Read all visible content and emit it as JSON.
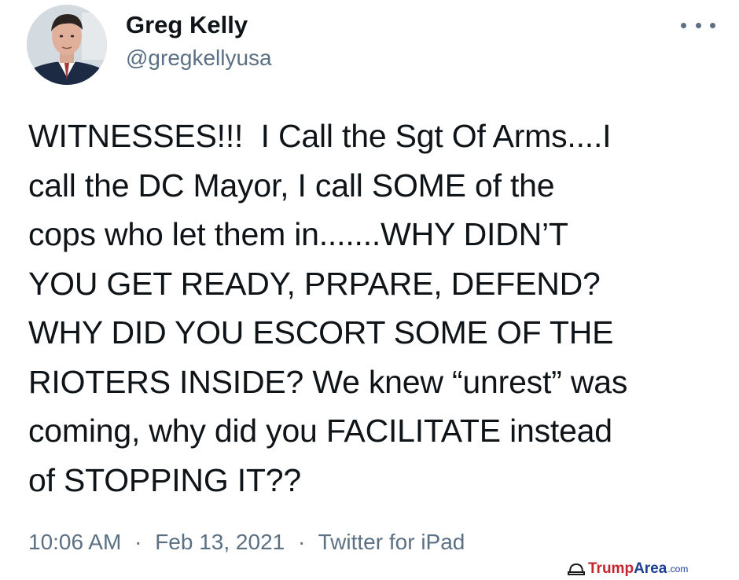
{
  "tweet": {
    "author_name": "Greg Kelly",
    "author_handle": "@gregkellyusa",
    "more_icon": "more-dots-icon",
    "text_lines": [
      "WITNESSES!!!  I Call the Sgt Of Arms....I",
      "call the DC Mayor, I call SOME of the",
      "cops who let them in.......WHY DIDN’T",
      "YOU GET READY, PRPARE, DEFEND?",
      "WHY DID YOU ESCORT SOME OF THE",
      "RIOTERS INSIDE? We knew “unrest” was",
      "coming, why did you FACILITATE instead",
      "of STOPPING IT??"
    ],
    "time": "10:06 AM",
    "date": "Feb 13, 2021",
    "separator": "·",
    "source": "Twitter for iPad"
  },
  "watermark": {
    "brand": "Trump",
    "site": "Area",
    "domain": ".com"
  },
  "colors": {
    "text": "#0f1419",
    "secondary": "#5b7083",
    "watermark_red": "#c4262e",
    "watermark_blue": "#1b3f8f"
  }
}
